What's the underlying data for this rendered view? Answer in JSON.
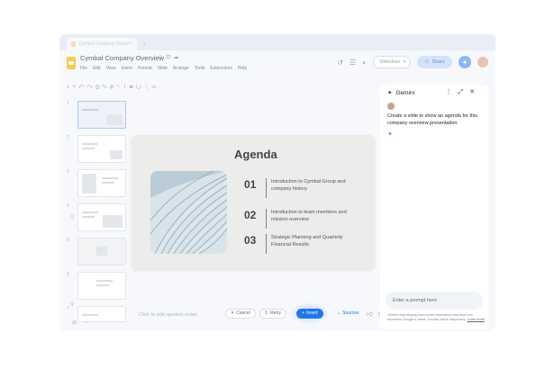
{
  "tab": {
    "label": "Cymbal Company Overview"
  },
  "header": {
    "title": "Cymbal Company Overview",
    "menus": [
      "File",
      "Edit",
      "View",
      "Insert",
      "Format",
      "Slide",
      "Arrange",
      "Tools",
      "Extensions",
      "Help"
    ],
    "slideshow_label": "Slideshow",
    "share_label": "Share"
  },
  "filmstrip": {
    "slide_numbers": [
      "1",
      "2",
      "3",
      "4",
      "5",
      "6",
      "7"
    ]
  },
  "slide": {
    "title": "Agenda",
    "items": [
      {
        "num": "01",
        "text": "Introduction to Cymbal Group and company history"
      },
      {
        "num": "02",
        "text": "Introduction to team members and mission overview"
      },
      {
        "num": "03",
        "text": "Strategic Planning and Quarterly Financial Results"
      }
    ]
  },
  "actions": {
    "cancel_label": "Cancel",
    "retry_label": "Retry",
    "insert_label": "Insert",
    "sources_label": "Sources"
  },
  "notes": {
    "placeholder": "Click to add speaker notes"
  },
  "gemini": {
    "title": "Gemini",
    "user_message": "Create a slide to show an agenda for this company overview presentation.",
    "input_placeholder": "Enter a prompt here",
    "disclaimer": "Gemini may display inaccurate information and does not represent Google's views. Double-check responses.",
    "learn_more": "Learn more"
  },
  "colors": {
    "accent": "#1a73e8",
    "gemini_spark": "#4285f4",
    "slide_bg": "#ececea"
  }
}
